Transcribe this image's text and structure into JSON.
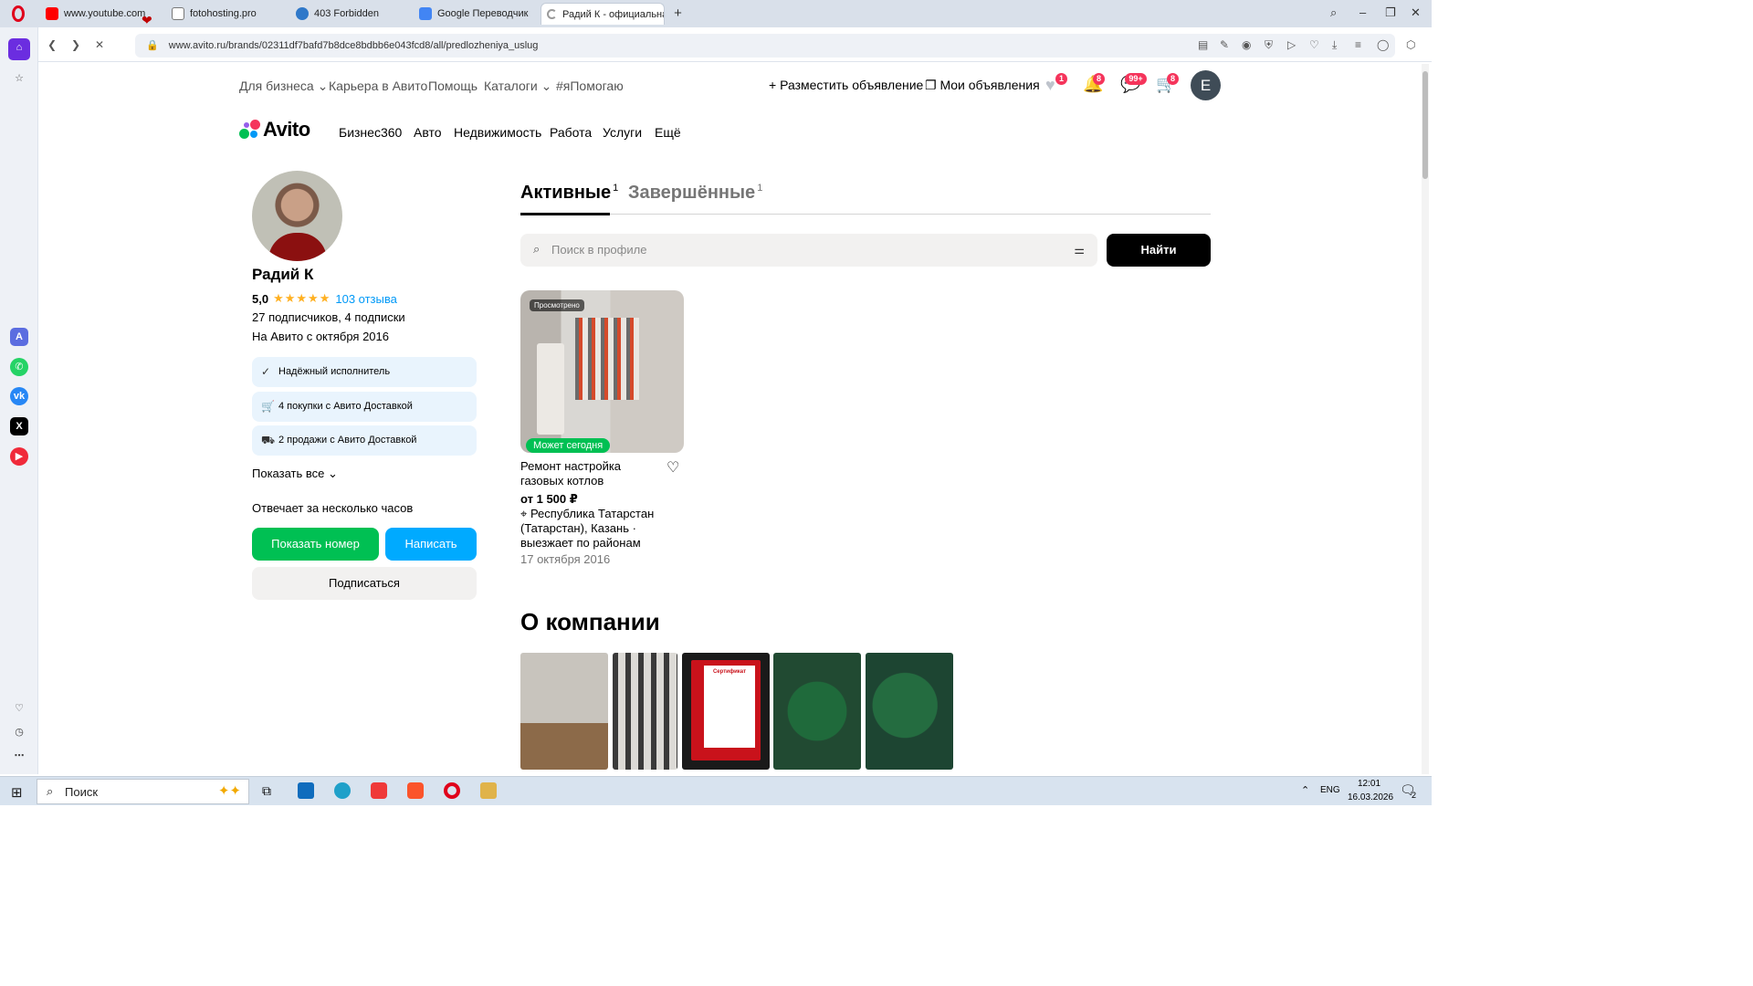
{
  "browser": {
    "tabs": [
      {
        "label": "www.youtube.com"
      },
      {
        "label": "fotohosting.pro"
      },
      {
        "label": "403 Forbidden"
      },
      {
        "label": "Google Переводчик"
      },
      {
        "label": "Радий К - официальная с"
      }
    ],
    "url": "www.avito.ru/brands/02311df7bafd7b8dce8bdbb6e043fcd8/all/predlozheniya_uslug"
  },
  "topnav": {
    "left": [
      "Для бизнеса",
      "Карьера в Авито",
      "Помощь",
      "Каталоги",
      "#яПомогаю"
    ],
    "post_ad": "Разместить объявление",
    "my_ads": "Мои объявления",
    "badges": {
      "favorites": "1",
      "notifications": "8",
      "messages": "99+",
      "cart": "8"
    },
    "avatar_letter": "E"
  },
  "brand": {
    "logo": "Avito"
  },
  "categories": [
    "Бизнес360",
    "Авто",
    "Недвижимость",
    "Работа",
    "Услуги",
    "Ещё"
  ],
  "profile": {
    "name": "Радий К",
    "rating": "5,0",
    "stars": 5,
    "reviews": "103 отзыва",
    "subscribers": "27 подписчиков, 4 подписки",
    "since": "На Авито с октября 2016",
    "chips": [
      "Надёжный исполнитель",
      "4 покупки с Авито Доставкой",
      "2 продажи с Авито Доставкой"
    ],
    "show_all": "Показать все",
    "response": "Отвечает за несколько часов",
    "show_phone": "Показать номер",
    "write": "Написать",
    "subscribe": "Подписаться"
  },
  "tabs": {
    "active": {
      "label": "Активные",
      "count": "1"
    },
    "finished": {
      "label": "Завершённые",
      "count": "1"
    }
  },
  "search": {
    "placeholder": "Поиск в профиле",
    "button": "Найти"
  },
  "listing": {
    "viewed_badge": "Просмотрено",
    "today_badge": "Может сегодня",
    "title": "Ремонт настройка газовых котлов",
    "price": "от 1 500 ₽",
    "location": "Республика Татарстан (Татарстан), Казань · выезжает по районам",
    "date": "17 октября 2016"
  },
  "about": {
    "title": "О компании",
    "certificate_label": "Сертификат"
  },
  "taskbar": {
    "search_placeholder": "Поиск",
    "lang": "ENG",
    "time": "12:01",
    "date": "16.03.2026",
    "notif_count": "2"
  },
  "colors": {
    "green": "#00c053",
    "blue": "#00aaff",
    "link": "#0099f7",
    "star": "#ffb021"
  }
}
